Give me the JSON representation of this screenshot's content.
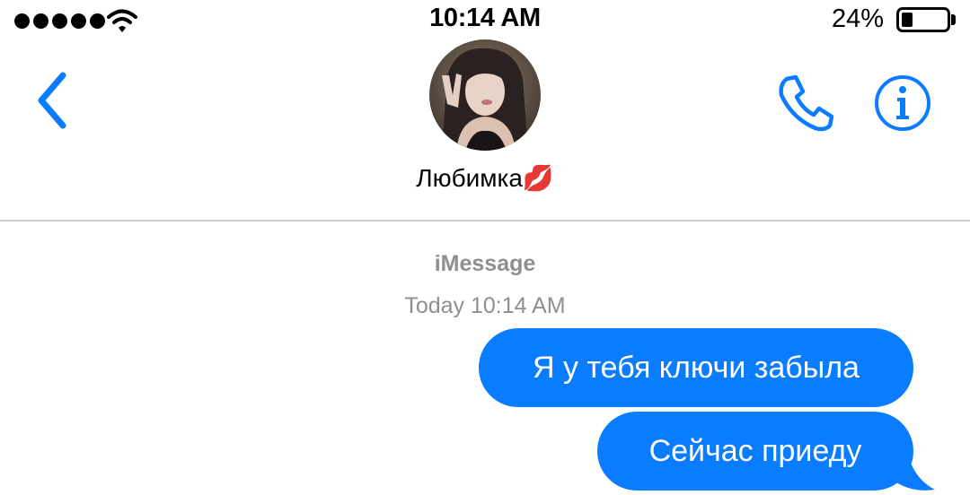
{
  "status_bar": {
    "time": "10:14 AM",
    "battery_percent": "24%",
    "battery_level": 0.24,
    "signal_bars": 5,
    "wifi_icon": "wifi-icon"
  },
  "header": {
    "back_icon": "chevron-left-icon",
    "contact_name": "Любимка💋",
    "call_icon": "phone-icon",
    "info_icon": "info-icon"
  },
  "conversation": {
    "service": "iMessage",
    "timestamp": "Today 10:14 AM",
    "messages": [
      {
        "text": "Я у тебя ключи забыла",
        "direction": "outgoing"
      },
      {
        "text": "Сейчас приеду",
        "direction": "outgoing"
      }
    ]
  },
  "colors": {
    "accent": "#0a7cff",
    "meta_text": "#8e8e93",
    "divider": "#d0d0d4"
  }
}
